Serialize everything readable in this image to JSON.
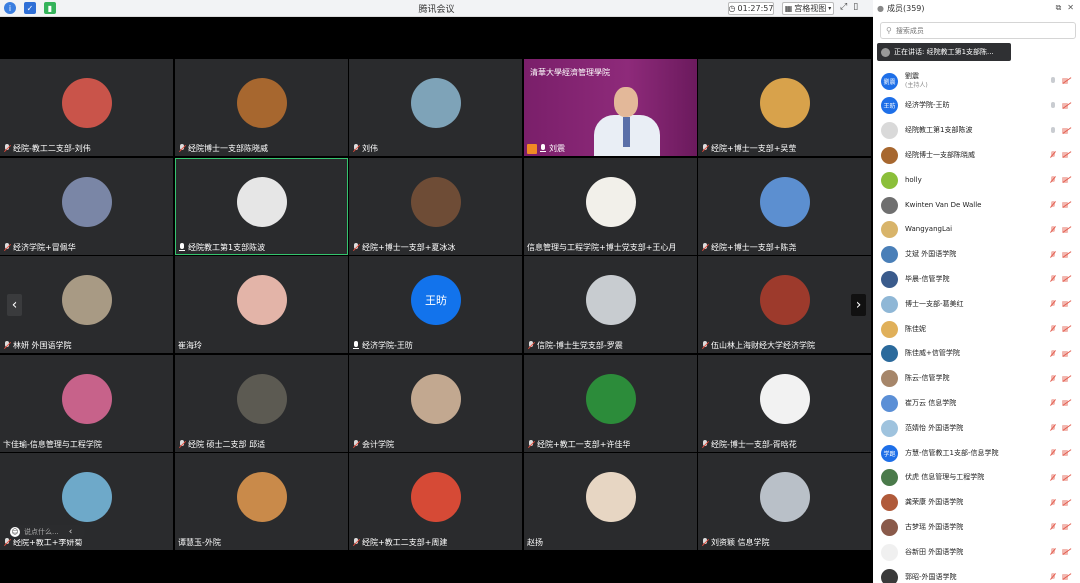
{
  "window": {
    "title": "腾讯会议",
    "timer": "01:27:57",
    "view_mode": "宫格视图"
  },
  "panel": {
    "title": "成员(359)",
    "search_placeholder": "搜索成员",
    "speaker_toast": "正在讲话: 经院教工第1支部陈..."
  },
  "chat": {
    "placeholder": "说点什么..."
  },
  "tiles": [
    {
      "label": "经院-教工二支部-刘伟",
      "mic": "muted",
      "color": "#c9544a"
    },
    {
      "label": "经院博士一支部陈晓威",
      "mic": "muted",
      "color": "#a7672f"
    },
    {
      "label": "刘伟",
      "mic": "muted",
      "color": "#7ea3b8"
    },
    {
      "label": "刘震",
      "mic": "on",
      "video": true,
      "banner": "清華大學經濟管理學院"
    },
    {
      "label": "经院+博士一支部+吴莹",
      "mic": "muted",
      "color": "#d8a24b"
    },
    {
      "label": "经济学院+冒佩华",
      "mic": "muted",
      "color": "#7a86a6"
    },
    {
      "label": "经院教工第1支部陈波",
      "mic": "on",
      "color": "#e6e6e6",
      "active": true
    },
    {
      "label": "经院+博士一支部+夏冰冰",
      "mic": "muted",
      "color": "#6e4c36"
    },
    {
      "label": "信息管理与工程学院+博士党支部+王心月",
      "mic": "none",
      "color": "#f2f0ea"
    },
    {
      "label": "经院+博士一支部+陈尧",
      "mic": "muted",
      "color": "#5c8fd0"
    },
    {
      "label": "林妍 外国语学院",
      "mic": "muted",
      "color": "#a89a84"
    },
    {
      "label": "崔海玲",
      "mic": "none",
      "color": "#e3b4a8"
    },
    {
      "label": "经济学院-王昉",
      "mic": "on",
      "color": "#1273ec",
      "initials": "王昉"
    },
    {
      "label": "信院-博士生党支部-罗震",
      "mic": "muted",
      "color": "#c8ccd0"
    },
    {
      "label": "伍山林上海财经大学经济学院",
      "mic": "muted",
      "color": "#9d3a2c"
    },
    {
      "label": "卞佳瑜-信息管理与工程学院",
      "mic": "none",
      "color": "#c7628a"
    },
    {
      "label": "经院 硕士二支部 邱适",
      "mic": "muted",
      "color": "#5c5a52"
    },
    {
      "label": "会计学院",
      "mic": "muted",
      "color": "#c2a890"
    },
    {
      "label": "经院+教工一支部+许佳华",
      "mic": "muted",
      "color": "#2c8c3a"
    },
    {
      "label": "经院-博士一支部-胥晗花",
      "mic": "muted",
      "color": "#f2f2f2"
    },
    {
      "label": "经院+教工+李妍菊",
      "mic": "muted",
      "color": "#6ea9c9"
    },
    {
      "label": "谭慧玉-外院",
      "mic": "none",
      "color": "#c98a4a"
    },
    {
      "label": "经院+教工二支部+周建",
      "mic": "muted",
      "color": "#d64a36"
    },
    {
      "label": "赵扬",
      "mic": "none",
      "color": "#e7d6c3"
    },
    {
      "label": "刘资颖 信息学院",
      "mic": "muted",
      "color": "#b9c0c8"
    }
  ],
  "members": [
    {
      "name": "劉震",
      "sub": "(主持人)",
      "avatar_color": "#1e6fe8",
      "avatar_text": "劉震",
      "mic": "grey",
      "cam": "off"
    },
    {
      "name": "经济学院-王昉",
      "avatar_color": "#1e6fe8",
      "avatar_text": "王昉",
      "mic": "grey",
      "cam": "off"
    },
    {
      "name": "经院教工第1支部陈波",
      "avatar_color": "#d9d9d9",
      "avatar_text": "",
      "mic": "grey",
      "cam": "off"
    },
    {
      "name": " 经院博士一支部陈晓威",
      "avatar_color": "#a7672f",
      "avatar_text": "",
      "mic": "muted",
      "cam": "off"
    },
    {
      "name": "holly",
      "avatar_color": "#8bbf3a",
      "avatar_text": "",
      "mic": "muted",
      "cam": "off"
    },
    {
      "name": "Kwinten Van De Walle",
      "avatar_color": "#6f6f6f",
      "avatar_text": "",
      "mic": "muted",
      "cam": "off"
    },
    {
      "name": "WangyangLai",
      "avatar_color": "#d8b46a",
      "avatar_text": "",
      "mic": "muted",
      "cam": "off"
    },
    {
      "name": "艾斌 外国语学院",
      "avatar_color": "#4a7fb8",
      "avatar_text": "",
      "mic": "muted",
      "cam": "off"
    },
    {
      "name": "毕晨-信管学院",
      "avatar_color": "#3a5b8c",
      "avatar_text": "",
      "mic": "muted",
      "cam": "off"
    },
    {
      "name": "博士一支部-葛美红",
      "avatar_color": "#8fb7d6",
      "avatar_text": "",
      "mic": "muted",
      "cam": "off"
    },
    {
      "name": "陈佳妮",
      "avatar_color": "#e0b05a",
      "avatar_text": "",
      "mic": "muted",
      "cam": "off"
    },
    {
      "name": "陈佳威+信管学院",
      "avatar_color": "#2b6a9c",
      "avatar_text": "",
      "mic": "muted",
      "cam": "off"
    },
    {
      "name": "陈云-信管学院",
      "avatar_color": "#a6866a",
      "avatar_text": "",
      "mic": "muted",
      "cam": "off"
    },
    {
      "name": "崔万云 信息学院",
      "avatar_color": "#5b8fd6",
      "avatar_text": "",
      "mic": "muted",
      "cam": "off"
    },
    {
      "name": "范婧怡 外国语学院",
      "avatar_color": "#9fc3de",
      "avatar_text": "",
      "mic": "muted",
      "cam": "off"
    },
    {
      "name": "方慧-信管教工1支部-信息学院",
      "avatar_color": "#1e6fe8",
      "avatar_text": "学跑",
      "mic": "muted",
      "cam": "off"
    },
    {
      "name": "伏虎 信息管理与工程学院",
      "avatar_color": "#4a7a4a",
      "avatar_text": "",
      "mic": "muted",
      "cam": "off"
    },
    {
      "name": "龚荣康 外国语学院",
      "avatar_color": "#b05a3a",
      "avatar_text": "",
      "mic": "muted",
      "cam": "off"
    },
    {
      "name": "古梦瑶 外国语学院",
      "avatar_color": "#8a5a4a",
      "avatar_text": "",
      "mic": "muted",
      "cam": "off"
    },
    {
      "name": "谷新田 外国语学院",
      "avatar_color": "#f0f0f0",
      "avatar_text": "",
      "mic": "muted",
      "cam": "off"
    },
    {
      "name": "郭昭-外国语学院",
      "avatar_color": "#3a3a3a",
      "avatar_text": "",
      "mic": "muted",
      "cam": "off"
    }
  ],
  "icons": {
    "info": "info-icon",
    "shield": "shield-icon",
    "signal": "signal-icon",
    "clock": "clock-icon",
    "grid": "grid-view-icon",
    "fullscreen": "fullscreen-icon",
    "sidebar": "sidebar-toggle-icon",
    "search": "search-icon",
    "smile": "emoji-icon"
  }
}
